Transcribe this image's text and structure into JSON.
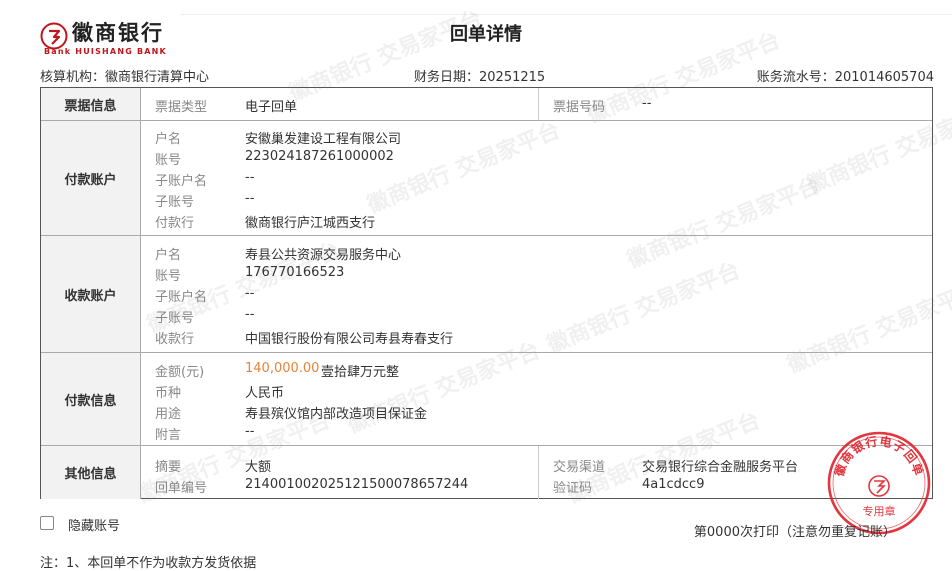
{
  "bank": {
    "logo_cn": "徽商银行",
    "logo_en": "Bank HUISHANG BANK",
    "brand_color": "#c0161c"
  },
  "title": "回单详情",
  "meta": {
    "org": "核算机构：徽商银行清算中心",
    "date": "财务日期：20251215",
    "serial": "账务流水号：201014605704"
  },
  "watermark_text": "徽商银行 交易家平台",
  "sections": {
    "voucher": {
      "header": "票据信息",
      "type_label": "票据类型",
      "type_value": "电子回单",
      "number_label": "票据号码",
      "number_value": "--"
    },
    "payer": {
      "header": "付款账户",
      "name_label": "户名",
      "name_value": "安徽巢发建设工程有限公司",
      "account_label": "账号",
      "account_value": "223024187261000002",
      "sub_name_label": "子账户名",
      "sub_name_value": "--",
      "sub_account_label": "子账号",
      "sub_account_value": "--",
      "bank_label": "付款行",
      "bank_value": "徽商银行庐江城西支行"
    },
    "payee": {
      "header": "收款账户",
      "name_label": "户名",
      "name_value": "寿县公共资源交易服务中心",
      "account_label": "账号",
      "account_value": "176770166523",
      "sub_name_label": "子账户名",
      "sub_name_value": "--",
      "sub_account_label": "子账号",
      "sub_account_value": "--",
      "bank_label": "收款行",
      "bank_value": "中国银行股份有限公司寿县寿春支行"
    },
    "payment": {
      "header": "付款信息",
      "amount_label": "金额(元)",
      "amount_value": "140,000.00",
      "amount_words": "壹拾肆万元整",
      "currency_label": "币种",
      "currency_value": "人民币",
      "purpose_label": "用途",
      "purpose_value": "寿县殡仪馆内部改造项目保证金",
      "remark_label": "附言",
      "remark_value": "--",
      "amount_color": "#e8833a"
    },
    "other": {
      "header": "其他信息",
      "summary_label": "摘要",
      "summary_value": "大额",
      "receipt_no_label": "回单编号",
      "receipt_no_value": "2140010020251215000786572​44",
      "channel_label": "交易渠道",
      "channel_value": "交易银行综合金融服务平台",
      "verify_label": "验证码",
      "verify_value": "4a1cdcc9"
    }
  },
  "stamp": {
    "top_text": "徽商银行电子回单",
    "bottom_text": "专用章",
    "color": "#e0202a"
  },
  "footer": {
    "hide_account": "隐藏账号",
    "print_info": "第0000次打印（注意勿重复记账）",
    "note": "注：1、本回单不作为收款方发货依据"
  }
}
